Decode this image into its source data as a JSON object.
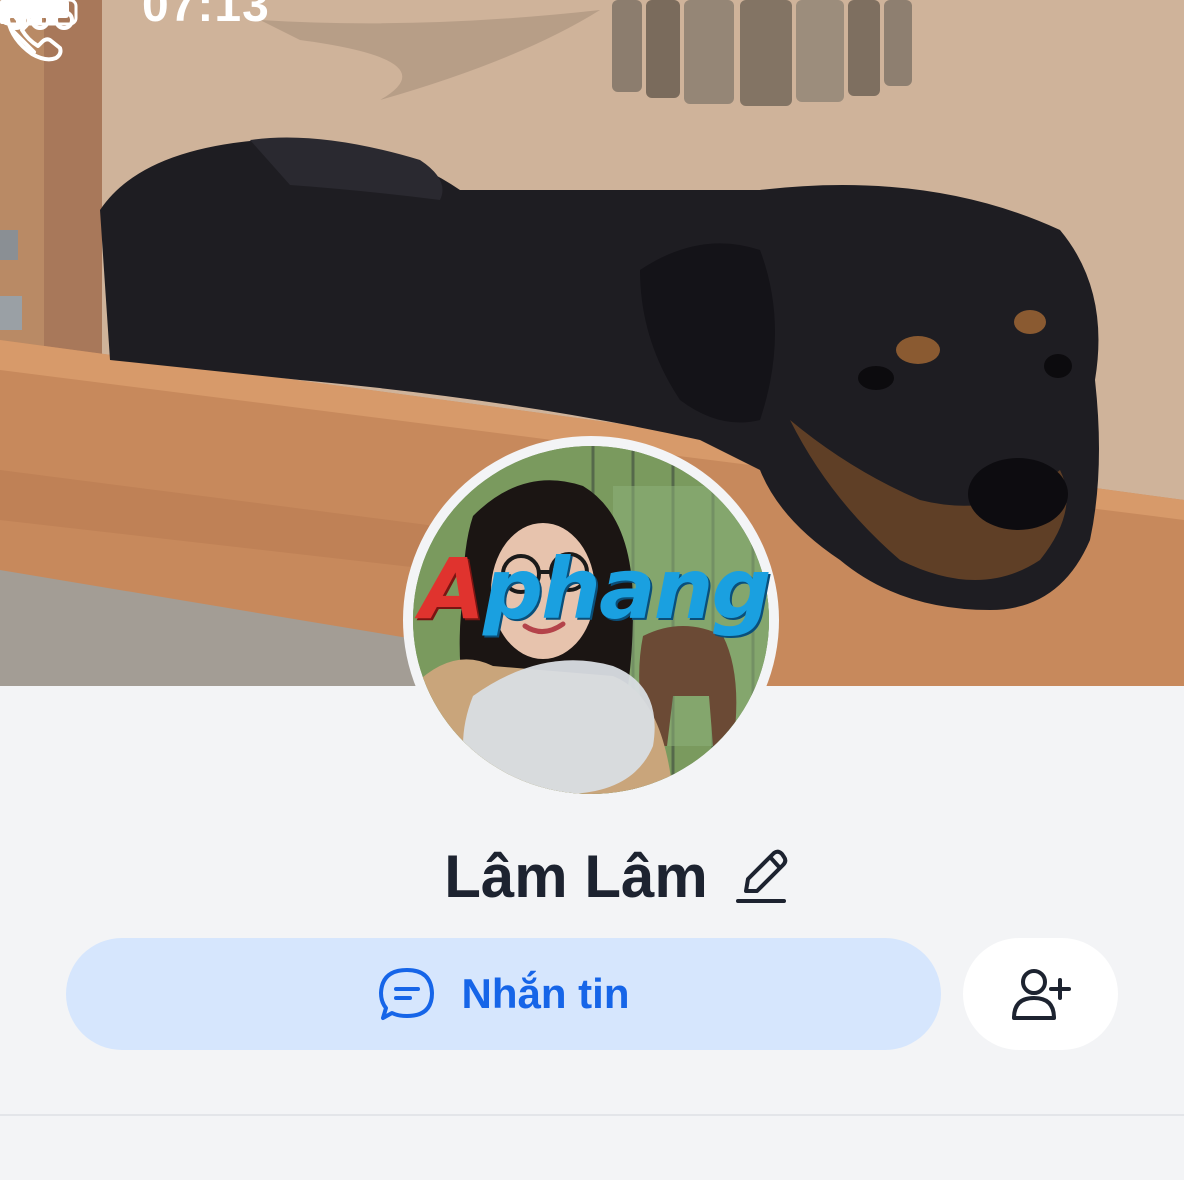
{
  "status_bar": {
    "time": "07:13"
  },
  "header": {
    "back_icon": "chevron-left-icon",
    "call_icon": "phone-icon",
    "more_icon": "more-horizontal-icon"
  },
  "cover": {
    "description_icon": "cover-photo"
  },
  "profile": {
    "name": "Lâm Lâm",
    "edit_icon": "pencil-icon",
    "watermark_text_a": "A",
    "watermark_text_rest": "phang"
  },
  "actions": {
    "message_label": "Nhắn tin",
    "message_icon": "chat-bubble-icon",
    "add_friend_icon": "user-plus-icon"
  },
  "colors": {
    "accent": "#1665e8",
    "message_button_bg": "#d6e6fd",
    "page_bg": "#f3f4f6",
    "name_text": "#1d2330"
  }
}
